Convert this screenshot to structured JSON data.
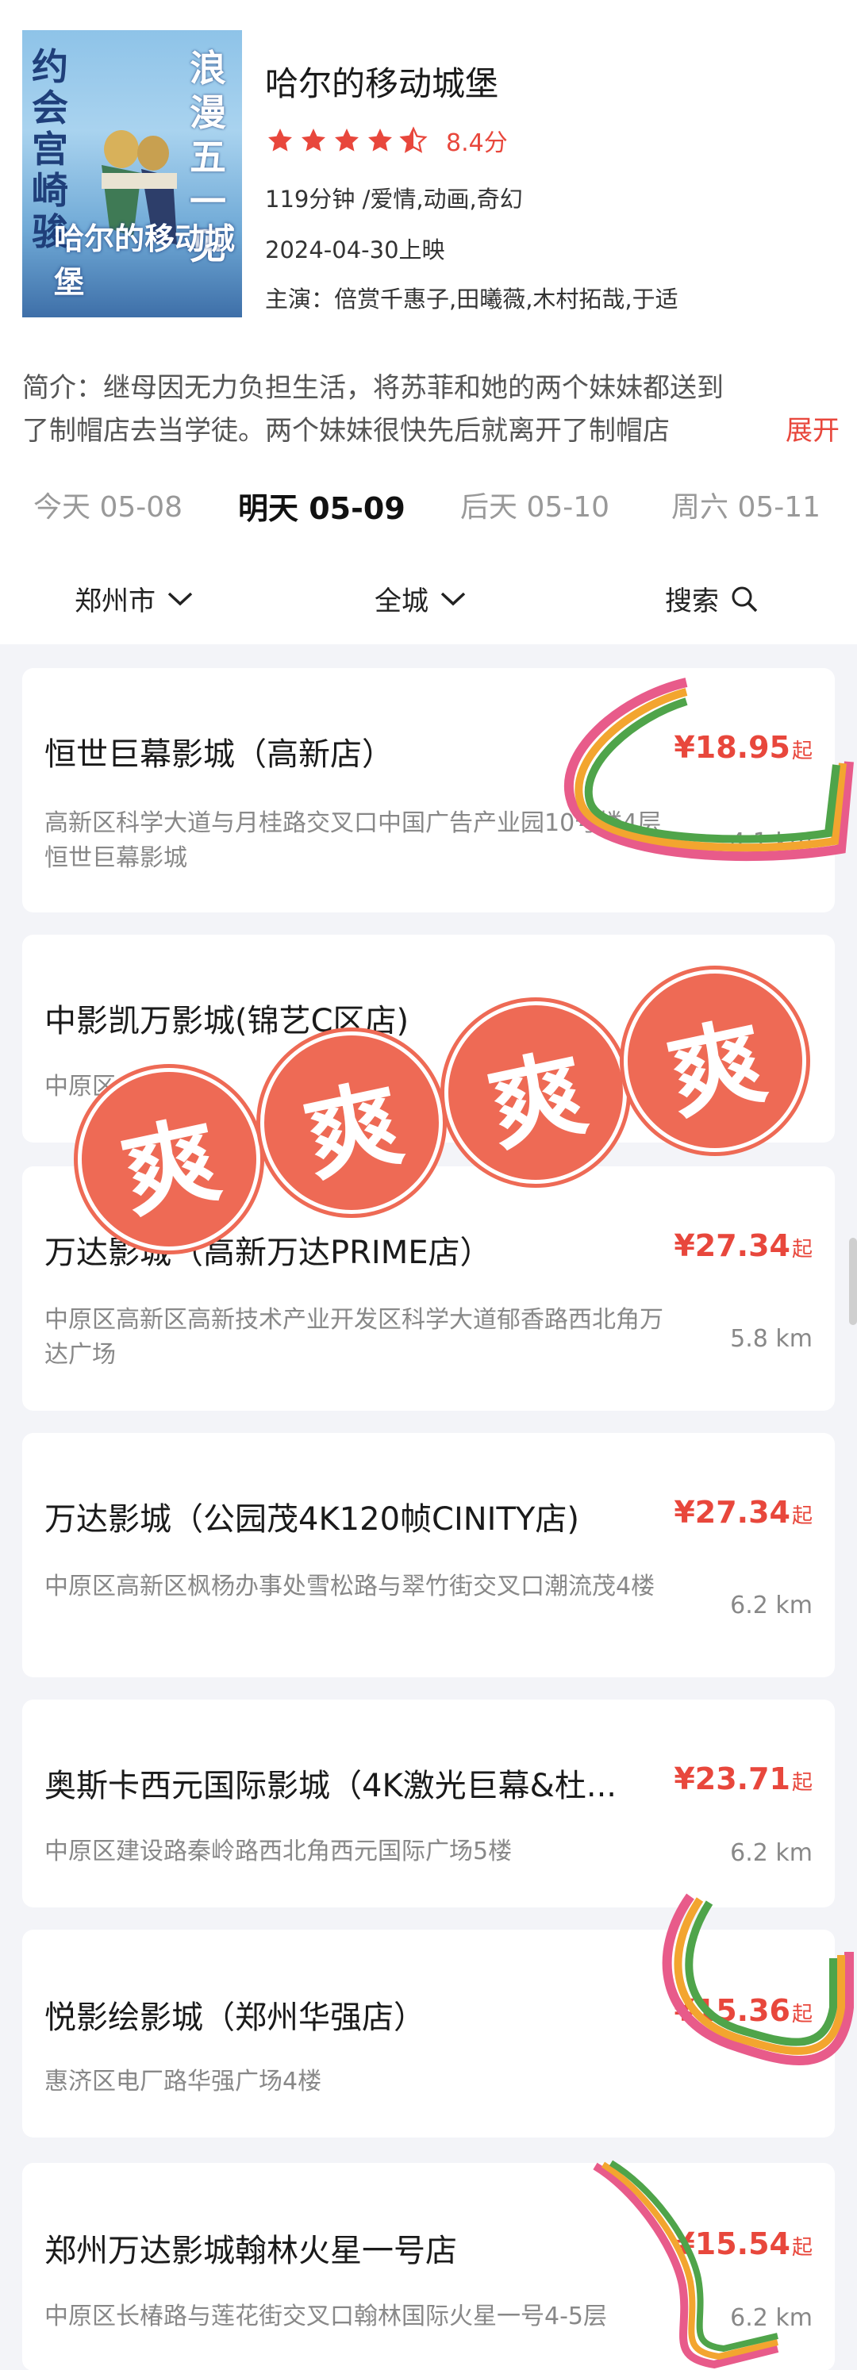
{
  "movie": {
    "poster_text_left": "约会宫崎骏",
    "poster_text_right": "浪漫五一见",
    "poster_logo": "哈尔的移动城堡",
    "title": "哈尔的移动城堡",
    "rating_stars": 4.5,
    "score": "8.4分",
    "duration_genre": "119分钟 /爱情,动画,奇幻",
    "release": "2024-04-30上映",
    "cast": "主演：倍赏千惠子,田曦薇,木村拓哉,于适",
    "intro_line1": "简介：继母因无力负担生活，将苏菲和她的两个妹妹都送到",
    "intro_line2": "了制帽店去当学徒。两个妹妹很快先后就离开了制帽店",
    "intro_more": "展开"
  },
  "dates": [
    {
      "label": "今天 05-08",
      "active": false
    },
    {
      "label": "明天 05-09",
      "active": true
    },
    {
      "label": "后天 05-10",
      "active": false
    },
    {
      "label": "周六 05-11",
      "active": false
    }
  ],
  "filters": {
    "city": "郑州市",
    "district": "全城",
    "search": "搜索"
  },
  "cinemas": [
    {
      "name": "恒世巨幕影城（高新店）",
      "price": "¥18.95",
      "suffix": "起",
      "address": "高新区科学大道与月桂路交叉口中国广告产业园10号楼4层恒世巨幕影城",
      "distance": "4.1 km"
    },
    {
      "name": "中影凯万影城(锦艺C区店)",
      "price": "",
      "suffix": "",
      "address": "中原区...",
      "distance": ""
    },
    {
      "name": "万达影城（高新万达PRIME店）",
      "price": "¥27.34",
      "suffix": "起",
      "address": "中原区高新区高新技术产业开发区科学大道郁香路西北角万达广场",
      "distance": "5.8 km"
    },
    {
      "name": "万达影城（公园茂4K120帧CINITY店)",
      "price": "¥27.34",
      "suffix": "起",
      "address": "中原区高新区枫杨办事处雪松路与翠竹街交叉口潮流茂4楼",
      "distance": "6.2 km"
    },
    {
      "name": "奥斯卡西元国际影城（4K激光巨幕&杜...",
      "price": "¥23.71",
      "suffix": "起",
      "address": "中原区建设路秦岭路西北角西元国际广场5楼",
      "distance": "6.2 km"
    },
    {
      "name": "悦影绘影城（郑州华强店）",
      "price": "¥15.36",
      "suffix": "起",
      "address": "惠济区电厂路华强广场4楼",
      "distance": ""
    },
    {
      "name": "郑州万达影城翰林火星一号店",
      "price": "¥15.54",
      "suffix": "起",
      "address": "中原区长椿路与莲花街交叉口翰林国际火星一号4-5层",
      "distance": "6.2 km"
    }
  ],
  "stamp_char": "爽",
  "colors": {
    "accent": "#e8473c",
    "stamp": "#ee6a55"
  }
}
